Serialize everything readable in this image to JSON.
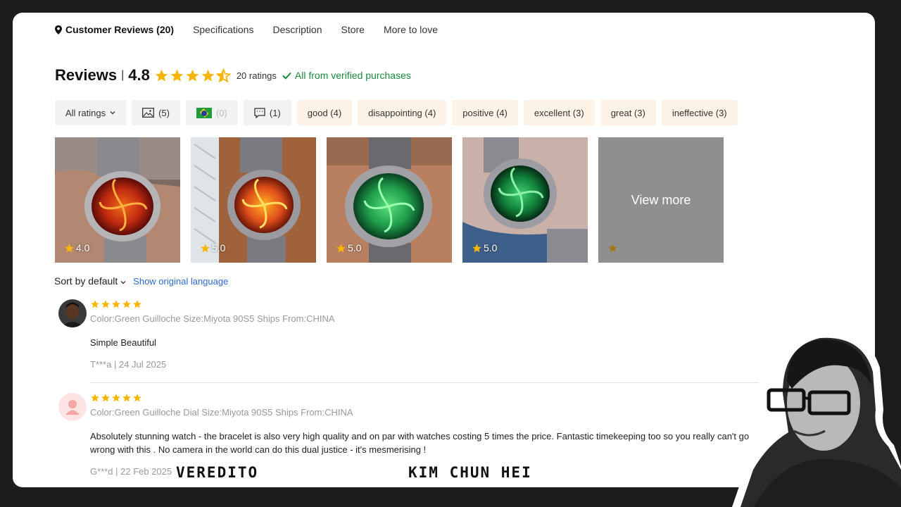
{
  "nav": {
    "items": [
      "Customer Reviews (20)",
      "Specifications",
      "Description",
      "Store",
      "More to love"
    ]
  },
  "reviews_header": {
    "title": "Reviews",
    "separator": "|",
    "score": "4.8",
    "count": "20 ratings",
    "verified": "All from verified purchases"
  },
  "filters": {
    "all_ratings": "All ratings",
    "photos": "(5)",
    "country": "(0)",
    "comments": "(1)",
    "tags": [
      "good (4)",
      "disappointing (4)",
      "positive (4)",
      "excellent (3)",
      "great (3)",
      "ineffective (3)"
    ]
  },
  "photos": {
    "ratings": [
      "4.0",
      "5.0",
      "5.0",
      "5.0"
    ],
    "view_more": "View more"
  },
  "sort": {
    "label": "Sort by default",
    "show_original": "Show original language"
  },
  "reviews": [
    {
      "attrs": "Color:Green Guilloche Size:Miyota 90S5 Ships From:CHINA",
      "text": "Simple Beautiful",
      "meta": "T***a | 24 Jul 2025",
      "stars": 5
    },
    {
      "attrs": "Color:Green Guilloche Dial Size:Miyota 90S5 Ships From:CHINA",
      "text": "Absolutely stunning watch - the bracelet is also very high quality and on par with watches costing 5 times the price. Fantastic timekeeping too so you really can't go wrong with this . No camera in the world can do this dual justice - it's mesmerising !",
      "meta": "G***d | 22 Feb 2025",
      "stars": 5
    }
  ],
  "captions": {
    "left": "VEREDITO",
    "right": "KIM CHUN HEI"
  },
  "colors": {
    "star": "#f7b500",
    "verified": "#1a8a3a",
    "link": "#2b6bd6",
    "chip_tag_bg": "#fdf3e6"
  }
}
